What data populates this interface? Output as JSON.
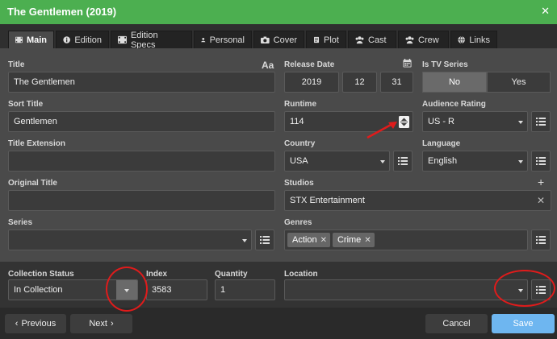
{
  "window": {
    "title": "The Gentlemen (2019)",
    "close_glyph": "✕"
  },
  "tabs": [
    {
      "label": "Main",
      "icon": "film-icon"
    },
    {
      "label": "Edition",
      "icon": "info-icon"
    },
    {
      "label": "Edition Specs",
      "icon": "film-icon"
    },
    {
      "label": "Personal",
      "icon": "person-icon"
    },
    {
      "label": "Cover",
      "icon": "camera-icon"
    },
    {
      "label": "Plot",
      "icon": "document-icon"
    },
    {
      "label": "Cast",
      "icon": "group-icon"
    },
    {
      "label": "Crew",
      "icon": "group-icon"
    },
    {
      "label": "Links",
      "icon": "globe-icon"
    }
  ],
  "labels": {
    "title": "Title",
    "release_date": "Release Date",
    "is_tv_series": "Is TV Series",
    "sort_title": "Sort Title",
    "runtime": "Runtime",
    "audience_rating": "Audience Rating",
    "title_extension": "Title Extension",
    "country": "Country",
    "language": "Language",
    "original_title": "Original Title",
    "studios": "Studios",
    "series": "Series",
    "genres": "Genres",
    "collection_status": "Collection Status",
    "index": "Index",
    "quantity": "Quantity",
    "location": "Location"
  },
  "fields": {
    "title": "The Gentlemen",
    "font_toggle": "Aa",
    "release_year": "2019",
    "release_month": "12",
    "release_day": "31",
    "tv_no": "No",
    "tv_yes": "Yes",
    "tv_selected": "No",
    "sort_title": "Gentlemen",
    "runtime": "114",
    "audience_rating": "US - R",
    "title_extension": "",
    "country": "USA",
    "language": "English",
    "original_title": "",
    "studios": "STX Entertainment",
    "series": "",
    "genres": [
      "Action",
      "Crime"
    ],
    "collection_status": "In Collection",
    "index": "3583",
    "quantity": "1",
    "location": ""
  },
  "footer": {
    "previous": "Previous",
    "next": "Next",
    "cancel": "Cancel",
    "save": "Save"
  },
  "colors": {
    "titlebar": "#4caf50",
    "save_button": "#6eb6f0",
    "annotation": "#e01b1b"
  }
}
